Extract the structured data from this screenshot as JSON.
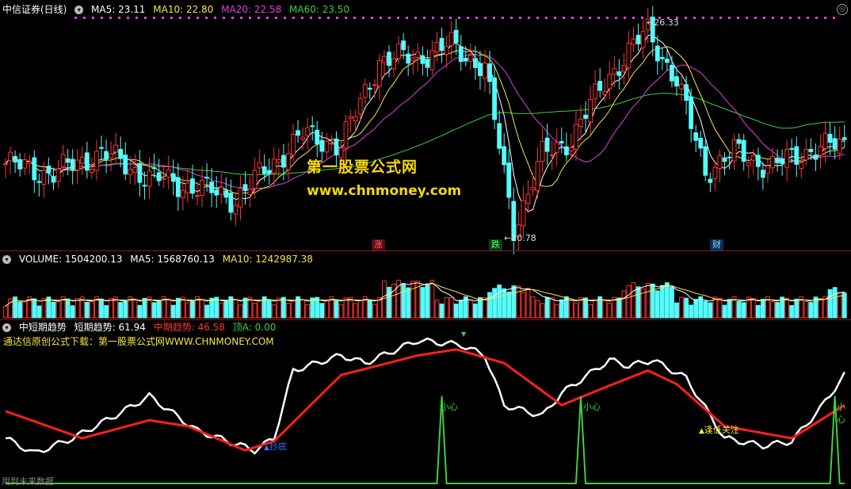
{
  "main_header": {
    "title": "中信证券(日线)",
    "ma5": "MA5: 23.11",
    "ma10": "MA10: 22.80",
    "ma20": "MA20: 22.58",
    "ma60": "MA60: 23.50"
  },
  "volume_header": {
    "volume": "VOLUME: 1504200.13",
    "ma5": "MA5: 1568760.13",
    "ma10": "MA10: 1242987.38"
  },
  "indicator_header": {
    "title": "中短期趋势",
    "short": "短期趋势: 61.94",
    "mid": "中期趋势: 46.58",
    "top": "顶A: 0.00"
  },
  "indicator_subtitle": "通达信原创公式下载：第一股票公式网WWW.CHNMONEY.COM",
  "watermark": {
    "line1": "第一股票公式网",
    "line2": "www.chnmoney.com"
  },
  "price_labels": {
    "high": "26.33",
    "low": "20.78"
  },
  "badges": {
    "rise": "涨",
    "fall": "跌",
    "fin": "财"
  },
  "indicator_labels": {
    "buy": "抄底",
    "careful1": "小心",
    "careful2": "小心",
    "careful3": "小心",
    "low_watch": "逢低关注",
    "top_cut": "▼",
    "future_data": "用到未来数据"
  },
  "colors": {
    "up": "#ff3232",
    "down": "#54fcfc",
    "ma5": "#ffffff",
    "ma10": "#f5e642",
    "ma20": "#e040e0",
    "ma60": "#3cd13c",
    "short_trend": "#ffffff",
    "mid_trend": "#ff1e1e",
    "top_signal": "#3cd13c",
    "header_ma5": "#ffffff",
    "header_ma10": "#f5e642",
    "header_ma20": "#e040e0",
    "header_ma60": "#3cd13c"
  },
  "chart_data": {
    "type": "candlestick",
    "price_range": [
      20.5,
      26.7
    ],
    "price_points": [
      {
        "index": 0,
        "value": 22.58
      },
      {
        "index": 10,
        "value": 22.3
      },
      {
        "index": 20,
        "value": 22.9
      },
      {
        "index": 30,
        "value": 22.2
      },
      {
        "index": 40,
        "value": 21.9
      },
      {
        "index": 48,
        "value": 21.6
      },
      {
        "index": 55,
        "value": 22.5
      },
      {
        "index": 62,
        "value": 23.4
      },
      {
        "index": 70,
        "value": 23.1
      },
      {
        "index": 78,
        "value": 25.5
      },
      {
        "index": 86,
        "value": 25.6
      },
      {
        "index": 93,
        "value": 25.9
      },
      {
        "index": 100,
        "value": 25.3
      },
      {
        "index": 106,
        "value": 20.78
      },
      {
        "index": 112,
        "value": 22.8
      },
      {
        "index": 118,
        "value": 23.3
      },
      {
        "index": 126,
        "value": 25.1
      },
      {
        "index": 134,
        "value": 26.33
      },
      {
        "index": 140,
        "value": 24.9
      },
      {
        "index": 146,
        "value": 22.4
      },
      {
        "index": 152,
        "value": 22.9
      },
      {
        "index": 160,
        "value": 22.5
      },
      {
        "index": 168,
        "value": 23.0
      },
      {
        "index": 175,
        "value": 23.11
      }
    ],
    "indicator": {
      "short_trend_last": 61.94,
      "mid_trend_last": 46.58,
      "top_a_last": 0.0
    }
  }
}
